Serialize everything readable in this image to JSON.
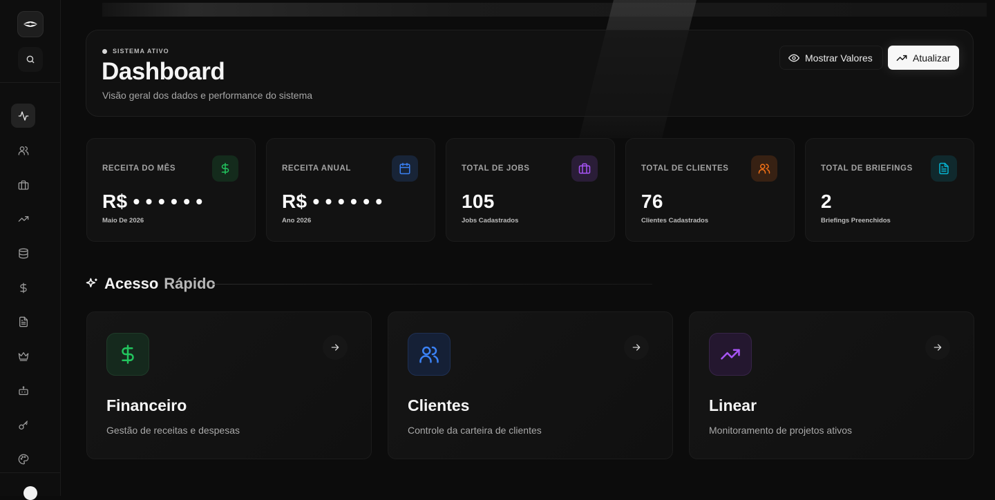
{
  "sidebar": {
    "items": [
      {
        "icon": "activity-icon"
      },
      {
        "icon": "users-icon"
      },
      {
        "icon": "briefcase-icon"
      },
      {
        "icon": "trending-up-icon"
      },
      {
        "icon": "database-icon"
      },
      {
        "icon": "dollar-icon"
      },
      {
        "icon": "file-text-icon"
      },
      {
        "icon": "crown-icon"
      },
      {
        "icon": "bot-icon"
      },
      {
        "icon": "key-icon"
      },
      {
        "icon": "palette-icon"
      }
    ]
  },
  "header": {
    "status": "SISTEMA ATIVO",
    "title": "Dashboard",
    "subtitle": "Visão geral dos dados e performance do sistema",
    "show_values_label": "Mostrar Valores",
    "update_label": "Atualizar"
  },
  "stats": [
    {
      "label": "RECEITA DO MÊS",
      "value": "R$ • • • • • •",
      "note": "Maio De 2026",
      "icon": "dollar-icon",
      "color": "#22c55e"
    },
    {
      "label": "RECEITA ANUAL",
      "value": "R$ • • • • • •",
      "note": "Ano 2026",
      "icon": "calendar-icon",
      "color": "#3b82f6"
    },
    {
      "label": "TOTAL DE JOBS",
      "value": "105",
      "note": "Jobs Cadastrados",
      "icon": "briefcase-icon",
      "color": "#a855f7"
    },
    {
      "label": "TOTAL DE CLIENTES",
      "value": "76",
      "note": "Clientes Cadastrados",
      "icon": "users-icon",
      "color": "#f97316"
    },
    {
      "label": "TOTAL DE BRIEFINGS",
      "value": "2",
      "note": "Briefings Preenchidos",
      "icon": "file-text-icon",
      "color": "#06b6d4"
    }
  ],
  "quick_access": {
    "title_a": "Acesso",
    "title_b": "Rápido",
    "cards": [
      {
        "title": "Financeiro",
        "desc": "Gestão de receitas e despesas",
        "icon": "dollar-icon",
        "color": "#22c55e"
      },
      {
        "title": "Clientes",
        "desc": "Controle da carteira de clientes",
        "icon": "users-icon",
        "color": "#3b82f6"
      },
      {
        "title": "Linear",
        "desc": "Monitoramento de projetos ativos",
        "icon": "trending-up-icon",
        "color": "#a855f7"
      }
    ]
  }
}
